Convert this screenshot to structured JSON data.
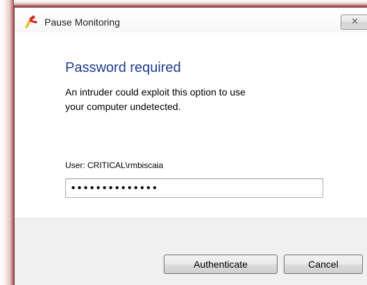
{
  "window": {
    "title": "Pause Monitoring",
    "icon": "app-logo-icon",
    "close_glyph": "✕",
    "close_icon": "close-icon"
  },
  "main": {
    "heading": "Password required",
    "message": "An intruder could exploit this option to use your computer undetected.",
    "user_label": "User: CRITICAL\\rmbiscaia",
    "password_value": "••••••••••••••"
  },
  "footer": {
    "authenticate_label": "Authenticate",
    "cancel_label": "Cancel"
  },
  "colors": {
    "heading": "#1f3d8a",
    "backdrop": "#8a2a2a",
    "footer_bg": "#f0f0f0"
  }
}
